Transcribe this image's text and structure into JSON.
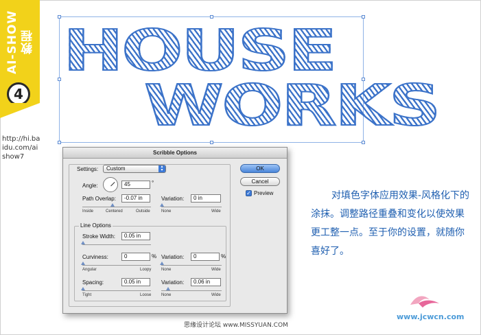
{
  "side_tab": {
    "title": "AI-SHOW教程",
    "number": "4",
    "url": "http://hi.baidu.com/aishow7"
  },
  "artwork": {
    "line1": "HOUSE",
    "line2": "WORKS",
    "color": "#3c73c9"
  },
  "dialog": {
    "title": "Scribble Options",
    "settings_label": "Settings:",
    "settings_value": "Custom",
    "angle_label": "Angle:",
    "angle_value": "45",
    "angle_unit": "°",
    "path_overlap_label": "Path Overlap:",
    "path_overlap_value": "-0.07 in",
    "path_overlap_variation_label": "Variation:",
    "path_overlap_variation_value": "0 in",
    "path_overlap_slider_labels": [
      "Inside",
      "Centered",
      "Outside"
    ],
    "variation_slider_labels": [
      "None",
      "Wide"
    ],
    "line_options_title": "Line Options",
    "stroke_width_label": "Stroke Width:",
    "stroke_width_value": "0.05 in",
    "curviness_label": "Curviness:",
    "curviness_value": "0",
    "curviness_unit": "%",
    "curviness_variation_label": "Variation:",
    "curviness_variation_value": "0",
    "curviness_variation_unit": "%",
    "curviness_slider_labels": [
      "Angular",
      "Loopy"
    ],
    "spacing_label": "Spacing:",
    "spacing_value": "0.05 in",
    "spacing_variation_label": "Variation:",
    "spacing_variation_value": "0.06 in",
    "spacing_slider_labels": [
      "Tight",
      "Loose"
    ],
    "ok_label": "OK",
    "cancel_label": "Cancel",
    "preview_label": "Preview",
    "preview_checked": true
  },
  "description": "对填色字体应用效果-风格化下的涂抹。调整路径重叠和变化以使效果更工整一点。至于你的设置，就随你喜好了。",
  "footer": "思缘设计论坛 www.MISSYUAN.COM",
  "watermark": "www.jcwcn.com"
}
